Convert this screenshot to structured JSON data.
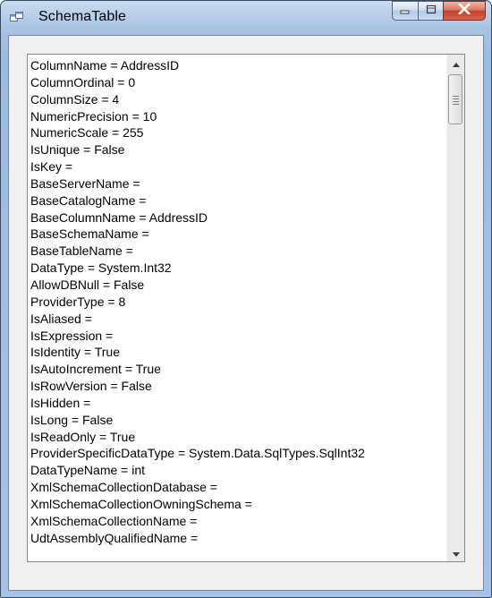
{
  "window": {
    "title": "SchemaTable",
    "caption": {
      "minimize_icon": "minimize-icon",
      "maximize_icon": "maximize-icon",
      "close_icon": "close-icon",
      "close_color": "#c2432b"
    }
  },
  "schema_rows": [
    "ColumnName = AddressID",
    "ColumnOrdinal = 0",
    "ColumnSize = 4",
    "NumericPrecision = 10",
    "NumericScale = 255",
    "IsUnique = False",
    "IsKey =",
    "BaseServerName =",
    "BaseCatalogName =",
    "BaseColumnName = AddressID",
    "BaseSchemaName =",
    "BaseTableName =",
    "DataType = System.Int32",
    "AllowDBNull = False",
    "ProviderType = 8",
    "IsAliased =",
    "IsExpression =",
    "IsIdentity = True",
    "IsAutoIncrement = True",
    "IsRowVersion = False",
    "IsHidden =",
    "IsLong = False",
    "IsReadOnly = True",
    "ProviderSpecificDataType = System.Data.SqlTypes.SqlInt32",
    "DataTypeName = int",
    "XmlSchemaCollectionDatabase =",
    "XmlSchemaCollectionOwningSchema =",
    "XmlSchemaCollectionName =",
    "UdtAssemblyQualifiedName ="
  ],
  "scroll_position": 0
}
